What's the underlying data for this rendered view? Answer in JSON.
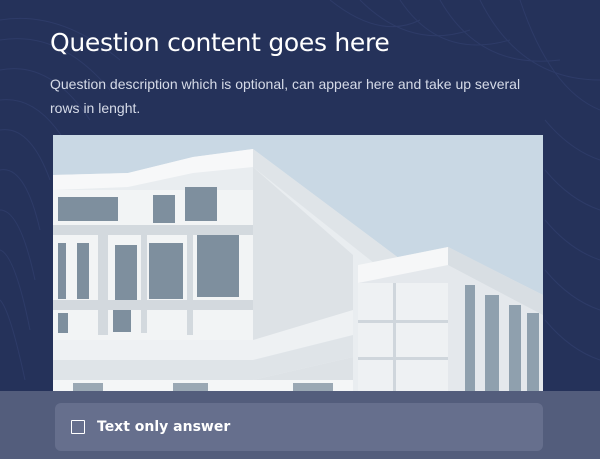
{
  "question": {
    "title": "Question content goes here",
    "description": "Question description which is optional, can appear here and take up several rows in lenght."
  },
  "image": {
    "subject": "modern white building facade against pale blue sky"
  },
  "answer": {
    "label": "Text only answer",
    "checked": false
  },
  "colors": {
    "background": "#25325a",
    "bottom_bar": "#535d7c",
    "option_bg": "#666f8d",
    "sky": "#c9d8e4"
  }
}
